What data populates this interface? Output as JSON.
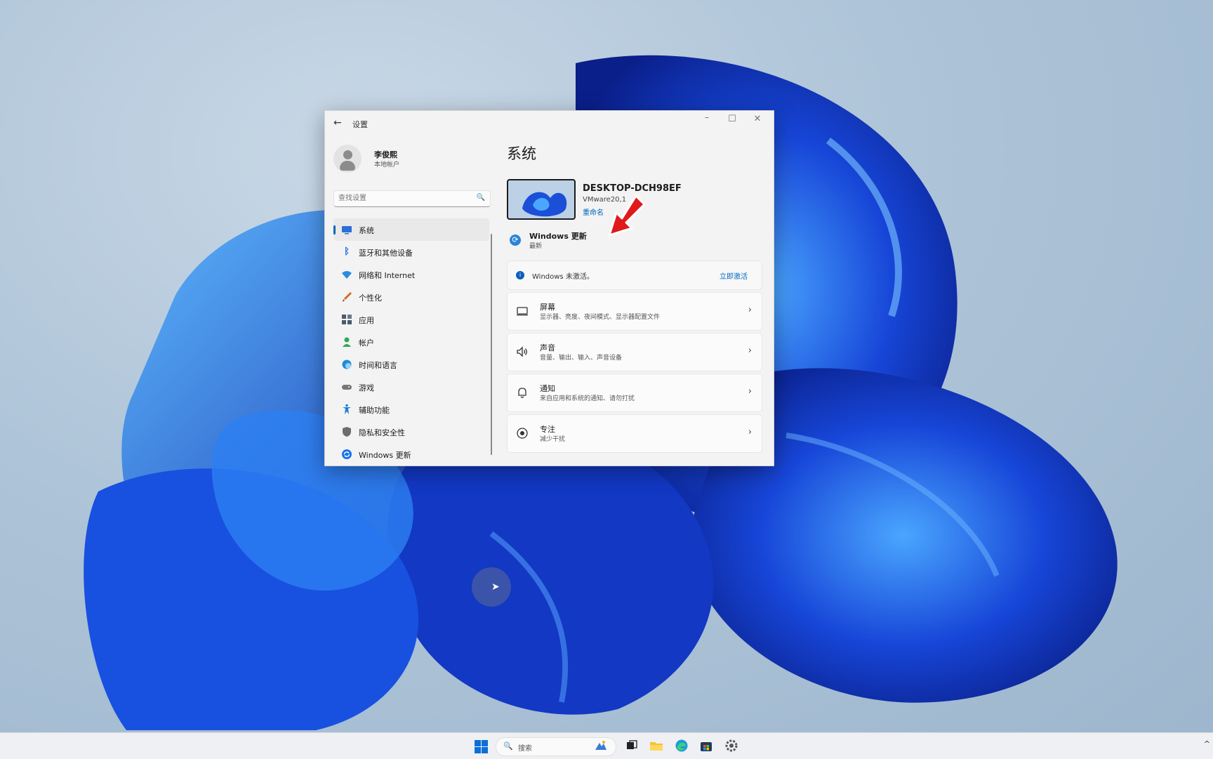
{
  "window": {
    "title": "设置",
    "back_icon": "arrow-left-icon",
    "controls": {
      "minimize": "–",
      "maximize": "☐",
      "close": "✕"
    }
  },
  "user": {
    "name": "李俊熙",
    "account_type": "本地帐户"
  },
  "search": {
    "placeholder": "查找设置",
    "icon": "search-icon"
  },
  "sidebar": {
    "items": [
      {
        "label": "系统",
        "icon": "monitor-icon",
        "active": true,
        "color": "#2b6fd6"
      },
      {
        "label": "蓝牙和其他设备",
        "icon": "bluetooth-icon",
        "color": "#1a73e8"
      },
      {
        "label": "网络和 Internet",
        "icon": "wifi-icon",
        "color": "#2b8be0"
      },
      {
        "label": "个性化",
        "icon": "brush-icon",
        "color": "#d2691e"
      },
      {
        "label": "应用",
        "icon": "apps-icon",
        "color": "#4a5a70"
      },
      {
        "label": "帐户",
        "icon": "account-icon",
        "color": "#2eaa56"
      },
      {
        "label": "时间和语言",
        "icon": "globe-clock-icon",
        "color": "#1f8ad8"
      },
      {
        "label": "游戏",
        "icon": "gamepad-icon",
        "color": "#777777"
      },
      {
        "label": "辅助功能",
        "icon": "accessibility-icon",
        "color": "#1e7fd8"
      },
      {
        "label": "隐私和安全性",
        "icon": "shield-icon",
        "color": "#6d6d6d"
      },
      {
        "label": "Windows 更新",
        "icon": "update-icon",
        "color": "#1a73e8"
      }
    ]
  },
  "main": {
    "title": "系统",
    "device": {
      "name": "DESKTOP-DCH98EF",
      "model": "VMware20,1",
      "rename": "重命名"
    },
    "windows_update": {
      "title": "Windows 更新",
      "status": "最新"
    },
    "activation": {
      "message": "Windows 未激活。",
      "action": "立即激活"
    },
    "cards": [
      {
        "title": "屏幕",
        "subtitle": "显示器、亮度、夜间模式、显示器配置文件",
        "icon": "display-icon"
      },
      {
        "title": "声音",
        "subtitle": "音量、输出、输入、声音设备",
        "icon": "speaker-icon"
      },
      {
        "title": "通知",
        "subtitle": "来自应用和系统的通知、请勿打扰",
        "icon": "bell-icon"
      },
      {
        "title": "专注",
        "subtitle": "减少干扰",
        "icon": "focus-icon"
      }
    ]
  },
  "taskbar": {
    "search_label": "搜索",
    "apps": [
      "widgets-icon",
      "task-view-icon",
      "file-explorer-icon",
      "edge-icon",
      "store-icon",
      "settings-icon"
    ]
  },
  "colors": {
    "accent": "#0067c0",
    "annotation_arrow": "#e0191a"
  }
}
